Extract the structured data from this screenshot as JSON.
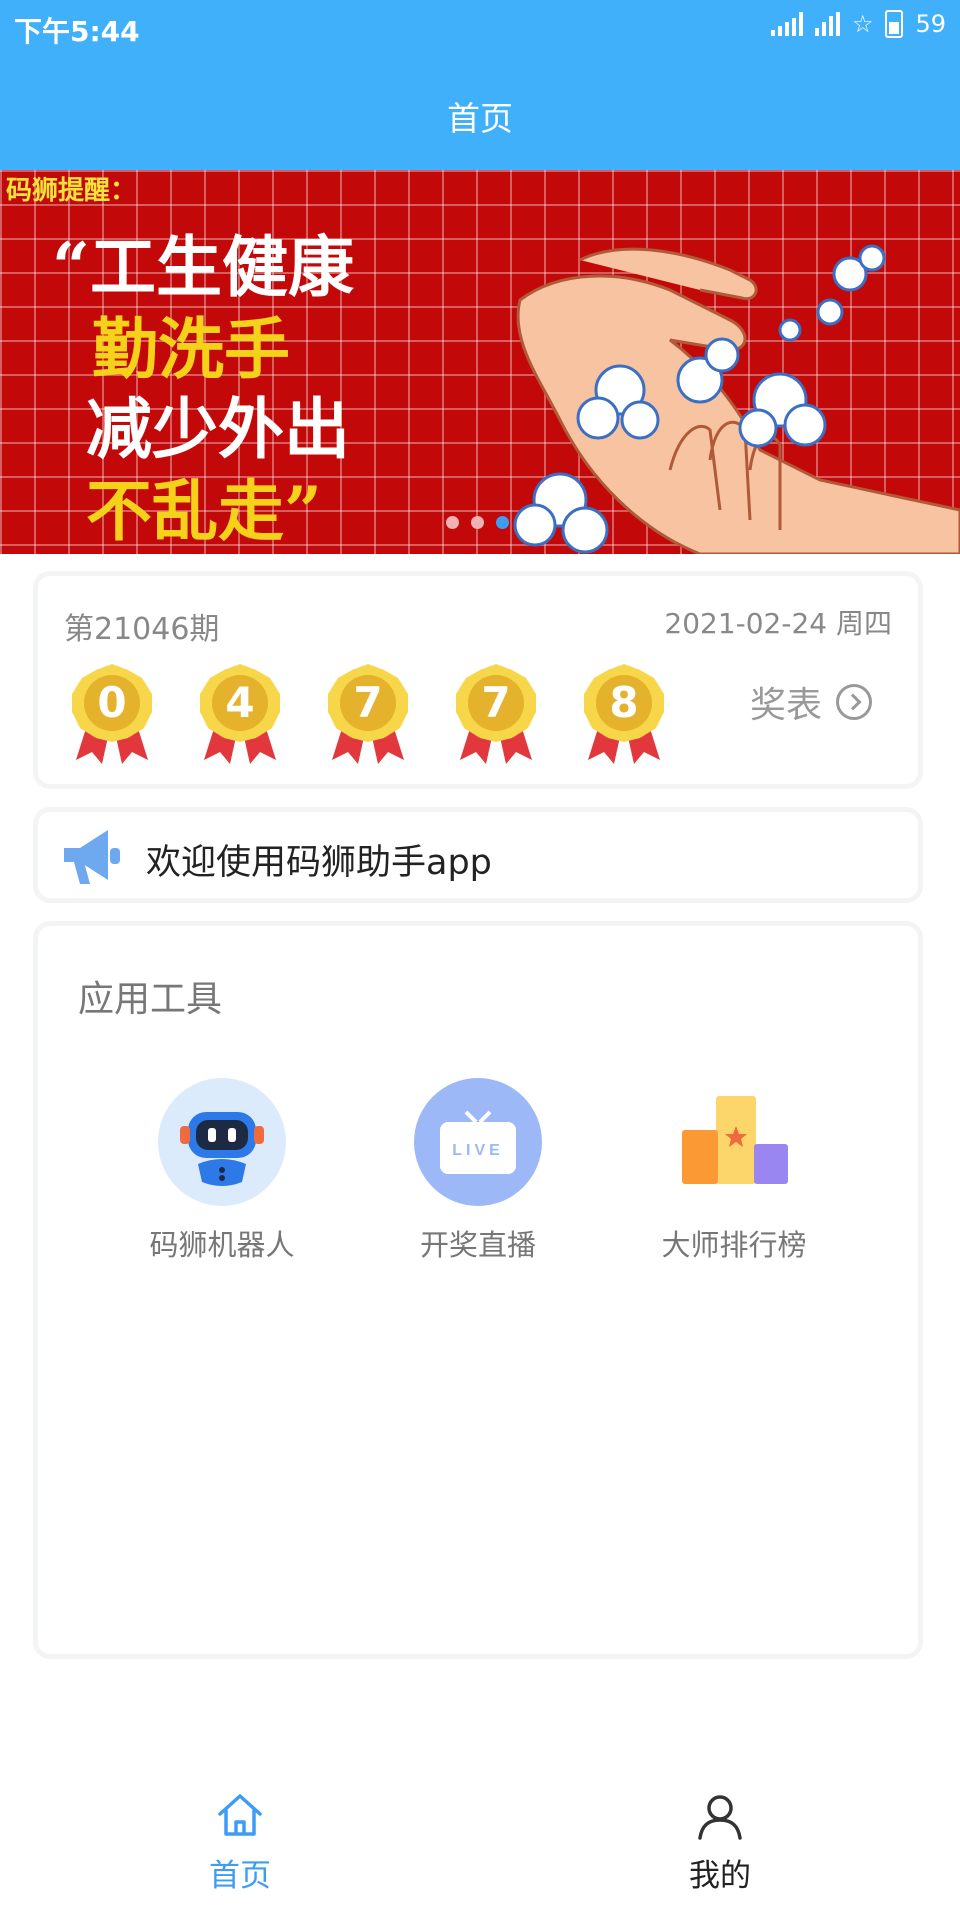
{
  "status_bar": {
    "time": "下午5:44",
    "battery": "59"
  },
  "header": {
    "title": "首页"
  },
  "banner": {
    "text_lines": [
      "码狮提醒：",
      "“工生健康",
      "勤洗手",
      "减少外出",
      "不乱走”"
    ],
    "dots": 3,
    "active_dot": 3
  },
  "lottery": {
    "issue": "第21046期",
    "date": "2021-02-24 周四",
    "numbers": [
      "0",
      "4",
      "7",
      "7",
      "8"
    ],
    "prize_table_label": "奖表"
  },
  "notice": {
    "text": "欢迎使用码狮助手app"
  },
  "tools": {
    "title": "应用工具",
    "items": [
      {
        "label": "码狮机器人",
        "icon": "robot-icon"
      },
      {
        "label": "开奖直播",
        "icon": "live-tv-icon"
      },
      {
        "label": "大师排行榜",
        "icon": "podium-icon"
      }
    ]
  },
  "bottom_nav": {
    "items": [
      {
        "label": "首页",
        "icon": "home-icon",
        "active": true
      },
      {
        "label": "我的",
        "icon": "user-icon",
        "active": false
      }
    ]
  },
  "colors": {
    "primary": "#40b0fb",
    "banner_red": "#c20808",
    "medal_gold": "#f2c232",
    "ribbon_red": "#e2373d",
    "nav_active": "#3d9df5"
  }
}
